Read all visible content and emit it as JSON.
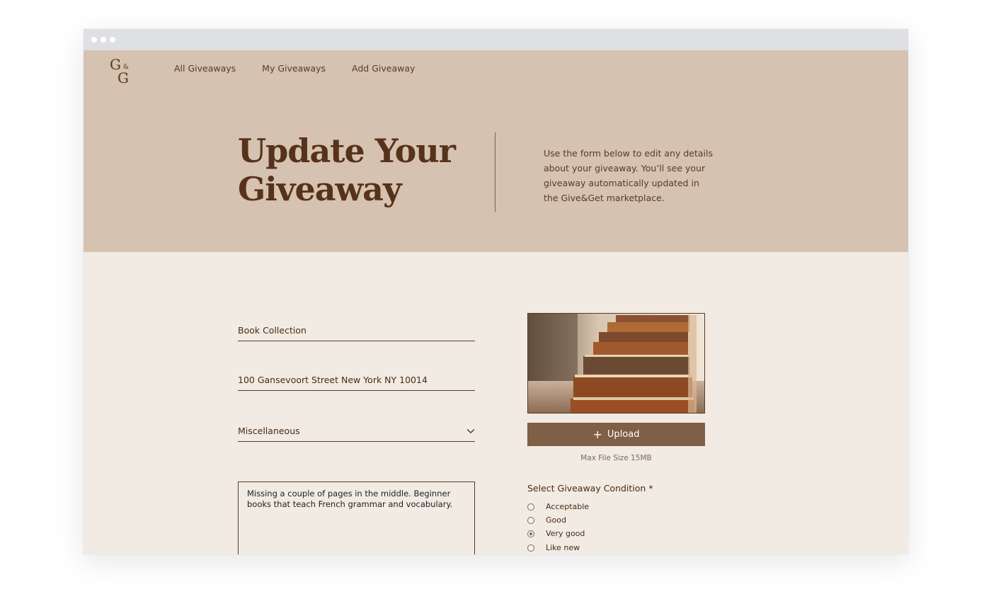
{
  "logo": {
    "letter_top": "G",
    "ampersand": "&",
    "letter_bottom": "G"
  },
  "nav": {
    "items": [
      {
        "label": "All Giveaways"
      },
      {
        "label": "My Giveaways"
      },
      {
        "label": "Add Giveaway"
      }
    ]
  },
  "hero": {
    "title_line1": "Update Your",
    "title_line2": "Giveaway",
    "description": "Use the form below to edit any details about your giveaway. You’ll see your giveaway automatically updated in the Give&Get marketplace."
  },
  "form": {
    "title_value": "Book Collection",
    "address_value": "100 Gansevoort Street New York NY 10014",
    "category_value": "Miscellaneous",
    "description_value": "Missing a couple of pages in the middle. Beginner books that teach French grammar and vocabulary.",
    "upload_label": "Upload",
    "max_file_size": "Max File Size 15MB",
    "condition_title": "Select Giveaway Condition *",
    "conditions": [
      {
        "label": "Acceptable",
        "checked": false
      },
      {
        "label": "Good",
        "checked": false
      },
      {
        "label": "Very good",
        "checked": true
      },
      {
        "label": "Like new",
        "checked": false
      }
    ]
  },
  "icons": {
    "upload": "plus-icon",
    "select": "chevron-down-icon"
  },
  "colors": {
    "hero_bg": "#d5c2b0",
    "page_bg": "#f1ebe3",
    "brand_brown": "#57321a",
    "button_bg": "#7f5f45"
  }
}
